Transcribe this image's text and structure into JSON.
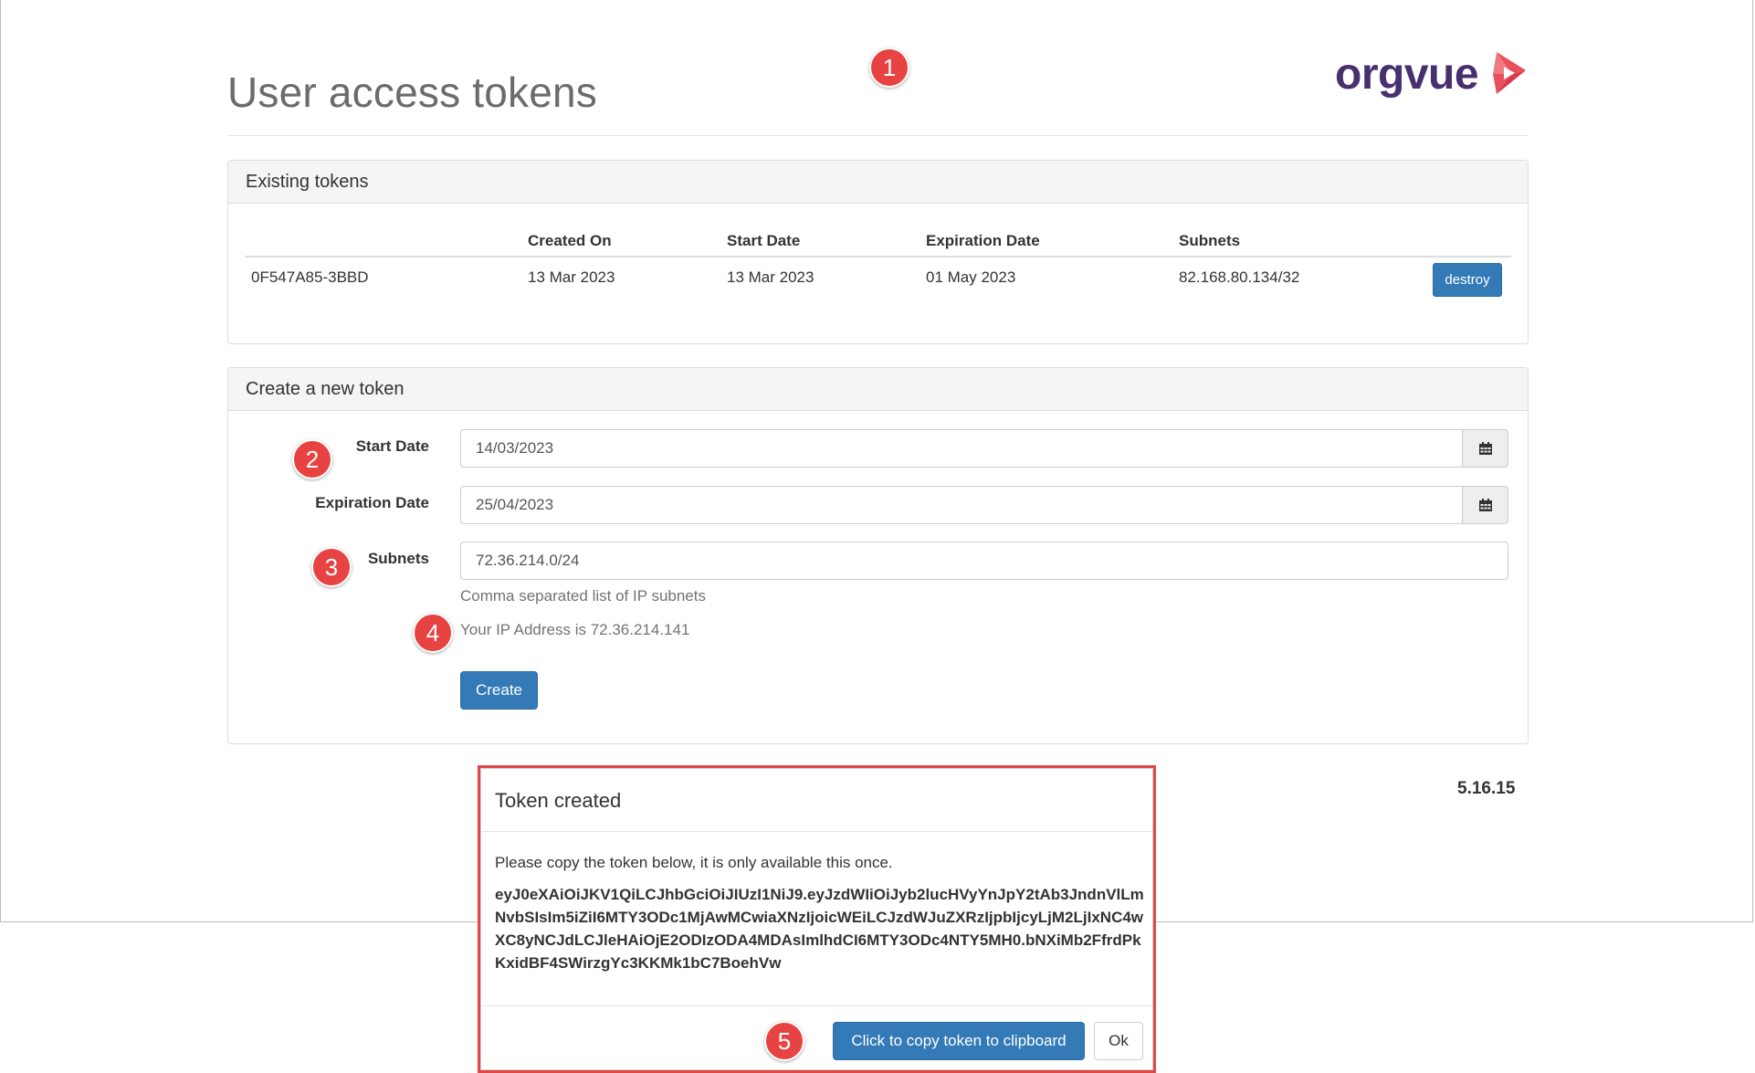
{
  "header": {
    "title": "User access tokens",
    "logo_text": "orgvue"
  },
  "existing": {
    "heading": "Existing tokens",
    "columns": [
      "",
      "Created On",
      "Start Date",
      "Expiration Date",
      "Subnets"
    ],
    "rows": [
      {
        "id": "0F547A85-3BBD",
        "created_on": "13 Mar 2023",
        "start_date": "13 Mar 2023",
        "expiration_date": "01 May 2023",
        "subnets": "82.168.80.134/32",
        "action_label": "destroy"
      }
    ]
  },
  "create": {
    "heading": "Create a new token",
    "start_date_label": "Start Date",
    "start_date_value": "14/03/2023",
    "expiration_label": "Expiration Date",
    "expiration_value": "25/04/2023",
    "subnets_label": "Subnets",
    "subnets_value": "72.36.214.0/24",
    "subnets_help": "Comma separated list of IP subnets",
    "ip_text": "Your IP Address is 72.36.214.141",
    "create_label": "Create",
    "calendar_icon": "calendar-icon"
  },
  "version": "5.16.15",
  "modal": {
    "title": "Token created",
    "message": "Please copy the token below, it is only available this once.",
    "token": "eyJ0eXAiOiJKV1QiLCJhbGciOiJIUzI1NiJ9.eyJzdWIiOiJyb2lucHVyYnJpY2tAb3JndnVlLmNvbSIsIm5iZiI6MTY3ODc1MjAwMCwiaXNzIjoicWEiLCJzdWJuZXRzIjpbIjcyLjM2LjIxNC4wXC8yNCJdLCJleHAiOjE2ODIzODA4MDAsImlhdCI6MTY3ODc4NTY5MH0.bNXiMb2FfrdPkKxidBF4SWirzgYc3KKMk1bC7BoehVw",
    "copy_label": "Click to copy token to clipboard",
    "ok_label": "Ok"
  },
  "callouts": [
    "1",
    "2",
    "3",
    "4",
    "5"
  ],
  "colors": {
    "primary": "#337ab7",
    "logo_purple": "#48306e",
    "logo_red": "#e8505b",
    "callout_red": "#e84343",
    "highlight_border": "#e04848"
  }
}
